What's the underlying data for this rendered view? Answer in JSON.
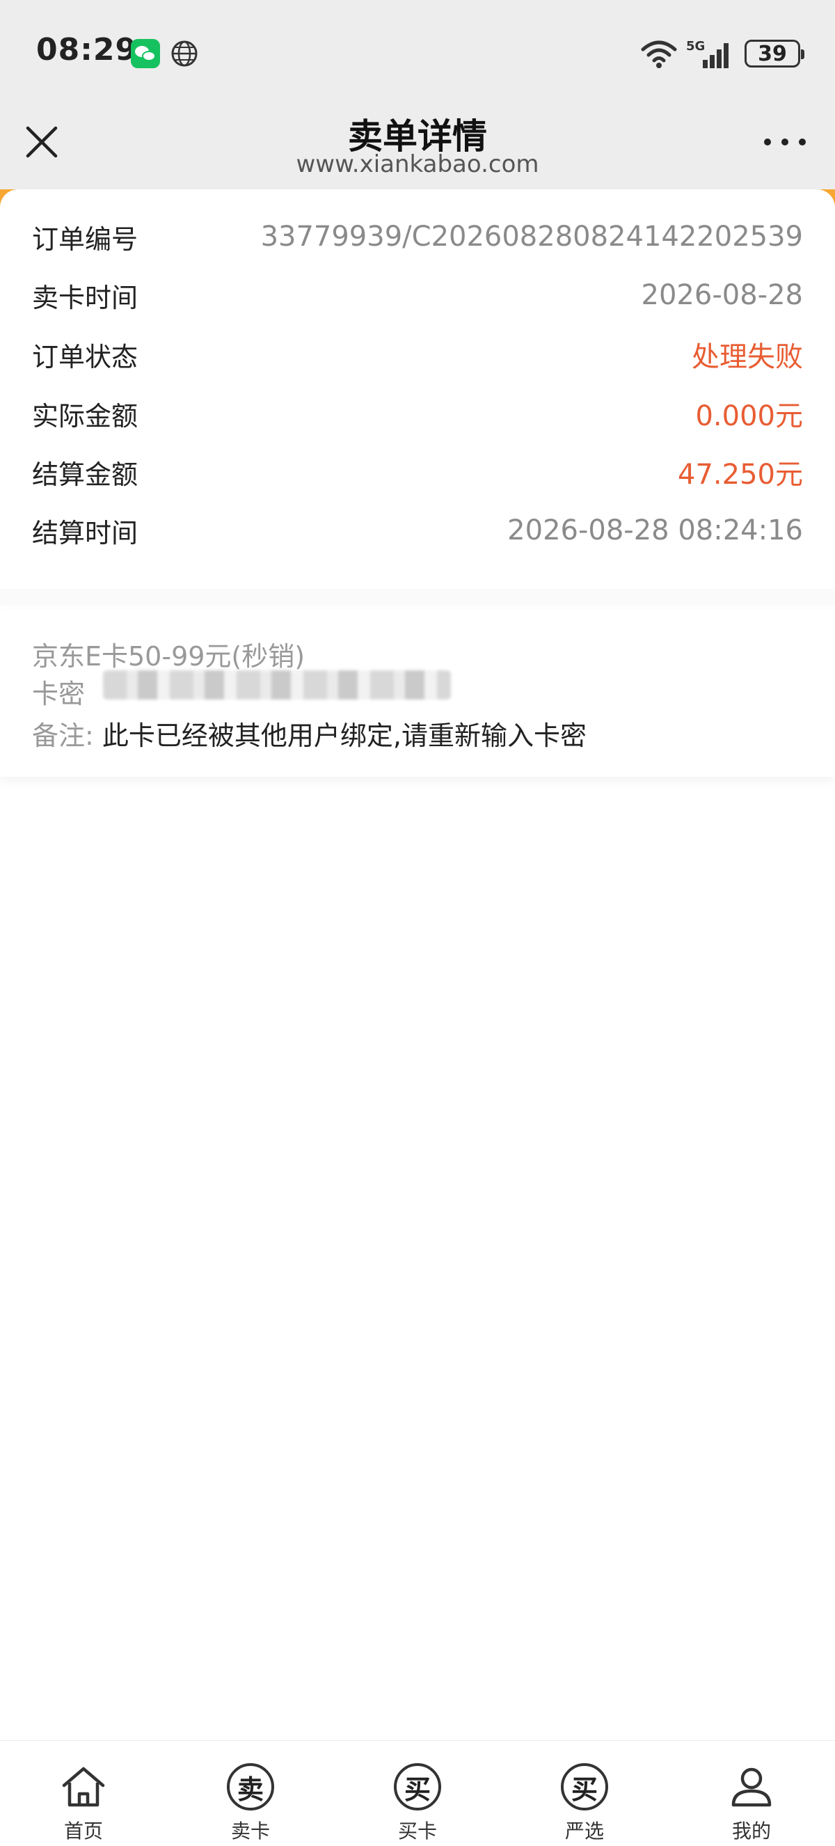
{
  "status_bar": {
    "time": "08:29",
    "network": "5G",
    "battery": "39",
    "icons": [
      "wechat-icon",
      "globe-icon",
      "wifi-icon",
      "signal-icon",
      "battery-icon"
    ]
  },
  "header": {
    "title": "卖单详情",
    "subtitle": "www.xiankabao.com",
    "close_icon": "close-icon",
    "more_icon": "more-icon"
  },
  "order": {
    "rows": [
      {
        "label": "订单编号",
        "value": "33779939/C202608280824142202539"
      },
      {
        "label": "卖卡时间",
        "value": "2026-08-28"
      },
      {
        "label": "订单状态",
        "value": "处理失败"
      },
      {
        "label": "实际金额",
        "value": "0.000元"
      },
      {
        "label": "结算金额",
        "value": "47.250元"
      },
      {
        "label": "结算时间",
        "value": "2026-08-28 08:24:16"
      }
    ]
  },
  "card_info": {
    "product": "京东E卡50-99元(秒销)",
    "card_secret_label": "卡密",
    "note_label": "备注:",
    "note_text": "此卡已经被其他用户绑定,请重新输入卡密"
  },
  "tabbar": {
    "items": [
      {
        "label": "首页",
        "icon": "home-icon"
      },
      {
        "label": "卖卡",
        "icon_char": "卖"
      },
      {
        "label": "买卡",
        "icon_char": "买"
      },
      {
        "label": "严选",
        "icon_char": "买"
      },
      {
        "label": "我的",
        "icon": "user-icon"
      }
    ]
  },
  "colors": {
    "accent_red": "#e85d33",
    "brand_orange": "#f7a833",
    "header_bg": "#ededed"
  }
}
